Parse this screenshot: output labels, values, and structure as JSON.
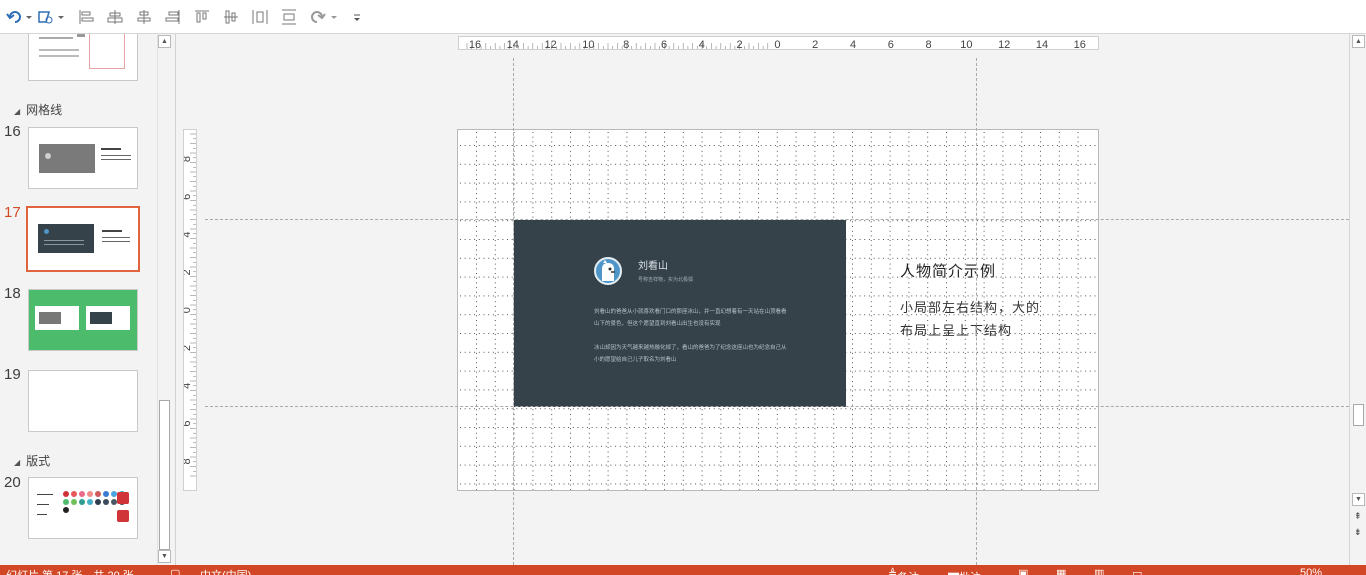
{
  "toolbar": {
    "icons": [
      "undo-icon",
      "redo-dropdown-icon",
      "shape-edit-icon",
      "align-left-icon",
      "align-center-icon",
      "align-right-icon",
      "align-top-icon",
      "align-middle-icon",
      "align-bottom-icon",
      "distribute-horizontal-icon",
      "distribute-vertical-icon",
      "redo-icon",
      "customize-toolbar-icon"
    ]
  },
  "thumbnails": {
    "sections": [
      {
        "label": "网格线"
      },
      {
        "label": "版式"
      }
    ],
    "slides": [
      {
        "number": "16"
      },
      {
        "number": "17",
        "selected": true
      },
      {
        "number": "18"
      },
      {
        "number": "19"
      },
      {
        "number": "20"
      }
    ]
  },
  "rulers": {
    "horizontal": [
      "16",
      "14",
      "12",
      "10",
      "8",
      "6",
      "4",
      "2",
      "0",
      "2",
      "4",
      "6",
      "8",
      "10",
      "12",
      "14",
      "16"
    ],
    "vertical": [
      "8",
      "6",
      "4",
      "2",
      "0",
      "2",
      "4",
      "6",
      "8"
    ]
  },
  "slide": {
    "card": {
      "name": "刘看山",
      "subtitle": "号称吉祥物，实为北极狐",
      "paragraph1": "刘看山的爸爸从小就喜欢看门口的那座冰山，并一直幻想着有一天站在山顶看看山下的景色，但这个愿望直到刘看山出生也没有实现",
      "paragraph2": "冰山却因为天气越来越热融化掉了，看山的爸爸为了纪念这座山也为纪念自己从小的愿望给自己儿子取名为刘看山"
    },
    "title": "人物简介示例",
    "description": "小局部左右结构，大的布局上呈上下结构"
  },
  "statusbar": {
    "slide_info": "幻灯片 第 17 张，共 20 张",
    "language": "中文(中国)",
    "notes_label": "备注",
    "comments_label": "批注",
    "zoom": "50%"
  },
  "colors": {
    "accent": "#d24726",
    "selection": "#e0643e",
    "card_bg": "#36424a",
    "slide18_bg": "#4cbb6c"
  }
}
